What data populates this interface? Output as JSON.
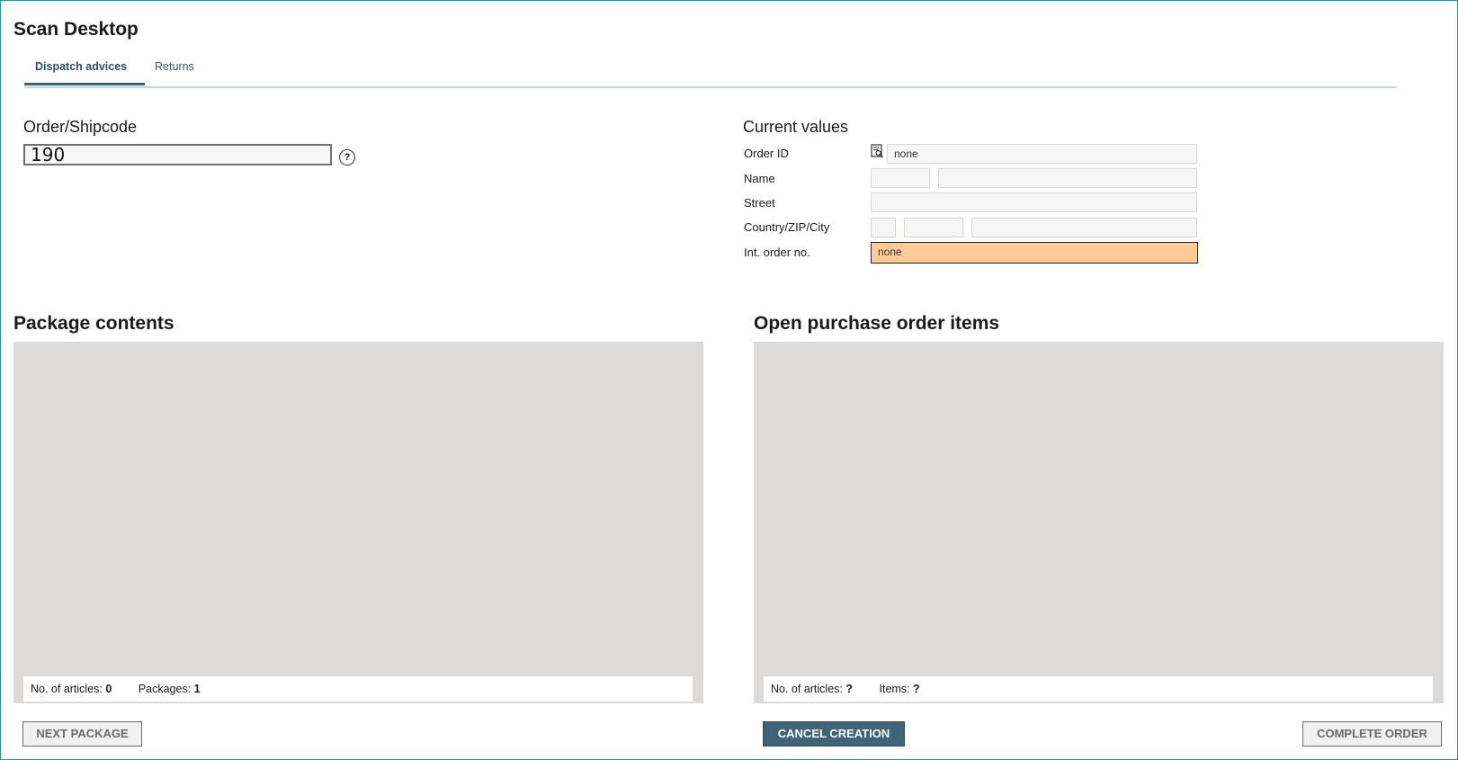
{
  "app": {
    "title": "Scan Desktop"
  },
  "tabs": [
    {
      "label": "Dispatch advices",
      "active": true
    },
    {
      "label": "Returns",
      "active": false
    }
  ],
  "order_shipcode": {
    "label": "Order/Shipcode",
    "value": "190",
    "help_icon": "question-circle-icon"
  },
  "current_values": {
    "title": "Current values",
    "order_id": {
      "label": "Order ID",
      "value": "none",
      "icon": "document-search-icon"
    },
    "name": {
      "label": "Name",
      "first": "",
      "last": ""
    },
    "street": {
      "label": "Street",
      "value": ""
    },
    "country_zip_city": {
      "label": "Country/ZIP/City",
      "country": "",
      "zip": "",
      "city": ""
    },
    "int_order_no": {
      "label": "Int. order no.",
      "value": "none",
      "highlight_color": "#ffcc99"
    }
  },
  "package_contents": {
    "title": "Package contents",
    "articles_label": "No. of articles:",
    "articles_value": "0",
    "packages_label": "Packages:",
    "packages_value": "1"
  },
  "open_po_items": {
    "title": "Open purchase order items",
    "articles_label": "No. of articles:",
    "articles_value": "?",
    "items_label": "Items:",
    "items_value": "?"
  },
  "buttons": {
    "next_package": "NEXT PACKAGE",
    "cancel_creation": "CANCEL CREATION",
    "complete_order": "COMPLETE ORDER"
  },
  "colors": {
    "accent": "#3f6478",
    "panel_bg": "#dcdbd9",
    "highlight": "#ffcc99"
  }
}
